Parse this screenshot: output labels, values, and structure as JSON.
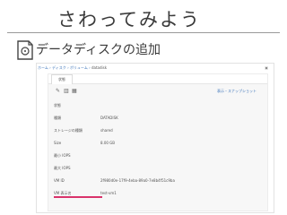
{
  "slide": {
    "title": "さわってみよう",
    "subtitle": "データディスクの追加"
  },
  "screenshot": {
    "breadcrumb": [
      "ホーム",
      "ディスク",
      "ボリューム",
      "datadisk"
    ],
    "tab_label": "状態",
    "toolbar_icons": [
      "pencil-icon",
      "trash-icon",
      "grid-icon"
    ],
    "toolbar_link": "表示・スナップショット",
    "properties": [
      {
        "key": "状態",
        "value": ""
      },
      {
        "key": "種類",
        "value": "DATADISK"
      },
      {
        "key": "ストレージの種類",
        "value": "shared"
      },
      {
        "key": "Size",
        "value": "8.00 GB"
      },
      {
        "key": "最小 IOPS",
        "value": ""
      },
      {
        "key": "最大 IOPS",
        "value": ""
      },
      {
        "key": "VM ID",
        "value": "2f980d0e-17f9-4eba-89a0-7e8b4f51c9ba"
      },
      {
        "key": "VM 表示名",
        "value": "test-vm1"
      }
    ],
    "highlight_color": "#d9336b"
  }
}
